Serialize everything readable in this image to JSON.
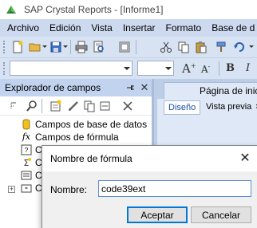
{
  "window": {
    "title": "SAP Crystal Reports - [Informe1]"
  },
  "menu": {
    "items": [
      "Archivo",
      "Edición",
      "Vista",
      "Insertar",
      "Formato",
      "Base de d"
    ]
  },
  "toolbar": {
    "font_grow_label": "A",
    "font_grow_sup": "+",
    "font_shrink_label": "A",
    "font_shrink_sup": "-",
    "bold_label": "B",
    "italic_label": "I"
  },
  "field_explorer": {
    "title": "Explorador de campos",
    "pin_glyph": "←",
    "close_glyph": "✕",
    "tree": [
      {
        "label": "Campos de base de datos",
        "icon": "database-icon"
      },
      {
        "label": "Campos de fórmula",
        "icon": "formula-icon"
      },
      {
        "label": "C",
        "icon": "parameter-icon"
      },
      {
        "label": "C",
        "icon": "running-total-icon"
      },
      {
        "label": "C",
        "icon": "group-name-icon"
      },
      {
        "label": "C",
        "icon": "special-fields-icon"
      }
    ]
  },
  "document": {
    "tab_label": "Página de inicio",
    "view_tabs": [
      {
        "label": "Diseño",
        "active": true
      },
      {
        "label": "Vista previa",
        "active": false
      },
      {
        "label": "×",
        "active": false
      }
    ]
  },
  "dialog": {
    "title": "Nombre de fórmula",
    "close_glyph": "✕",
    "name_label": "Nombre:",
    "name_value": "code39ext",
    "ok_label": "Aceptar",
    "cancel_label": "Cancelar"
  },
  "colors": {
    "menu_bar": "#ccd9ee",
    "toolbar": "#d7e2f2",
    "panel_header": "#c1d3ee",
    "accent": "#0078d7"
  }
}
